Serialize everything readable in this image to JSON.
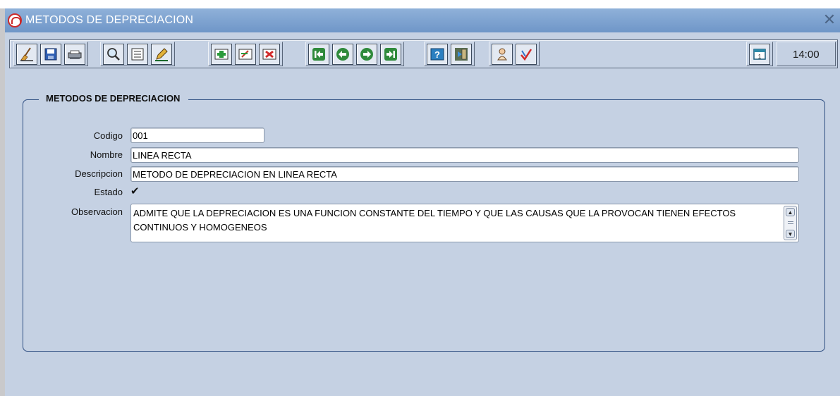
{
  "window": {
    "title": "METODOS DE DEPRECIACION",
    "close_glyph": "✕"
  },
  "toolbar": {
    "buttons": [
      {
        "name": "clear-icon",
        "tooltip": ""
      },
      {
        "name": "save-icon",
        "tooltip": ""
      },
      {
        "name": "print-icon",
        "tooltip": ""
      },
      {
        "name": "search-icon",
        "tooltip": ""
      },
      {
        "name": "list-icon",
        "tooltip": ""
      },
      {
        "name": "edit-icon",
        "tooltip": ""
      },
      {
        "name": "insert-record-icon",
        "tooltip": ""
      },
      {
        "name": "duplicate-record-icon",
        "tooltip": ""
      },
      {
        "name": "delete-record-icon",
        "tooltip": ""
      },
      {
        "name": "first-record-icon",
        "tooltip": ""
      },
      {
        "name": "previous-record-icon",
        "tooltip": ""
      },
      {
        "name": "next-record-icon",
        "tooltip": ""
      },
      {
        "name": "last-record-icon",
        "tooltip": ""
      },
      {
        "name": "help-icon",
        "tooltip": ""
      },
      {
        "name": "exit-icon",
        "tooltip": ""
      },
      {
        "name": "user-icon",
        "tooltip": ""
      },
      {
        "name": "spellcheck-icon",
        "tooltip": ""
      },
      {
        "name": "calendar-icon",
        "tooltip": ""
      }
    ],
    "clock": "14:00"
  },
  "form": {
    "section_title": "METODOS DE DEPRECIACION",
    "labels": {
      "codigo": "Codigo",
      "nombre": "Nombre",
      "descripcion": "Descripcion",
      "estado": "Estado",
      "observacion": "Observacion"
    },
    "values": {
      "codigo": "001",
      "nombre": "LINEA RECTA",
      "descripcion": "METODO DE DEPRECIACION EN LINEA RECTA",
      "estado_checked": true,
      "estado_glyph": "✔",
      "observacion": "ADMITE QUE LA DEPRECIACION ES UNA FUNCION CONSTANTE DEL TIEMPO Y QUE LAS CAUSAS QUE LA PROVOCAN TIENEN EFECTOS CONTINUOS Y HOMOGENEOS"
    }
  },
  "colors": {
    "titlebar": "#7aa0cf",
    "background": "#c5d1e3",
    "group_border": "#2f4f82"
  }
}
